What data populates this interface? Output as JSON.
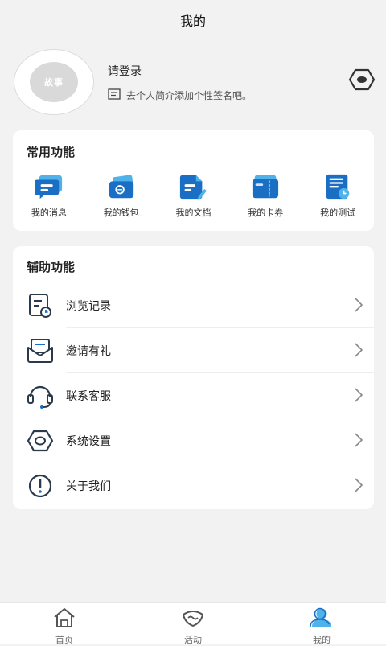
{
  "header": {
    "title": "我的"
  },
  "profile": {
    "avatar_text": "故事",
    "login_text": "请登录",
    "signature_hint": "去个人简介添加个性签名吧。"
  },
  "common": {
    "title": "常用功能",
    "items": [
      {
        "label": "我的消息",
        "icon": "message-icon"
      },
      {
        "label": "我的钱包",
        "icon": "wallet-icon"
      },
      {
        "label": "我的文档",
        "icon": "document-icon"
      },
      {
        "label": "我的卡券",
        "icon": "coupon-icon"
      },
      {
        "label": "我的测试",
        "icon": "test-icon"
      }
    ]
  },
  "aux": {
    "title": "辅助功能",
    "items": [
      {
        "label": "浏览记录",
        "icon": "history-icon"
      },
      {
        "label": "邀请有礼",
        "icon": "invite-icon"
      },
      {
        "label": "联系客服",
        "icon": "headset-icon"
      },
      {
        "label": "系统设置",
        "icon": "settings-icon"
      },
      {
        "label": "关于我们",
        "icon": "info-icon"
      }
    ]
  },
  "tabbar": {
    "tabs": [
      {
        "label": "首页",
        "icon": "home-icon"
      },
      {
        "label": "活动",
        "icon": "activity-icon"
      },
      {
        "label": "我的",
        "icon": "user-icon",
        "active": true
      }
    ]
  },
  "colors": {
    "accent": "#1a6fc4",
    "accent_light": "#4fb3ea",
    "background": "#f2f2f2",
    "dark_icon": "#2b3a4a"
  }
}
